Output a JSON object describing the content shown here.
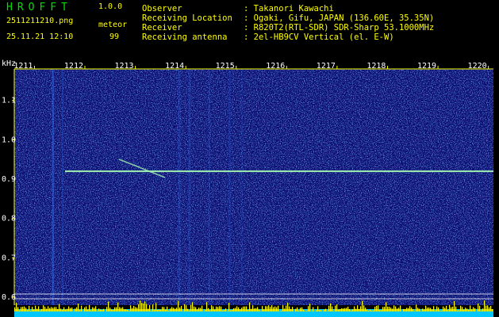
{
  "header": {
    "app_name": "HROFFT",
    "version": "1.0.0",
    "filename": "2511211210.png",
    "datetime": "25.11.21 12:10",
    "meteor_label": "meteor",
    "meteor_count": "99",
    "info": [
      {
        "key": "Observer",
        "value": ": Takanori Kawachi"
      },
      {
        "key": "Receiving Location",
        "value": ": Ogaki, Gifu, JAPAN (136.60E, 35.35N)"
      },
      {
        "key": "Receiver",
        "value": ": R820T2(RTL-SDR) SDR-Sharp 53.1000MHz"
      },
      {
        "key": "Receiving antenna",
        "value": ": 2el-HB9CV Vertical (el. E-W)"
      }
    ]
  },
  "chart_data": {
    "type": "heatmap",
    "ylabel": "kHz",
    "x_ticks": [
      "1211",
      "1212",
      "1213",
      "1214",
      "1215",
      "1216",
      "1217",
      "1218",
      "1219",
      "1220"
    ],
    "y_ticks": [
      "1.1",
      "1.0",
      "0.9",
      "0.8",
      "0.7",
      "0.6"
    ],
    "ylim": [
      0.58,
      1.18
    ],
    "xlim": [
      1210.6,
      1220.1
    ],
    "carrier_khz": 0.92,
    "colors": {
      "background": "#0a0a6e",
      "noise": "#2c6cf0",
      "carrier": "#9ff0b0",
      "axis": "#ffff00",
      "ticks": "#ffffff",
      "echo_bar": "#ffff00",
      "echo_base": "#00c8ff"
    }
  }
}
